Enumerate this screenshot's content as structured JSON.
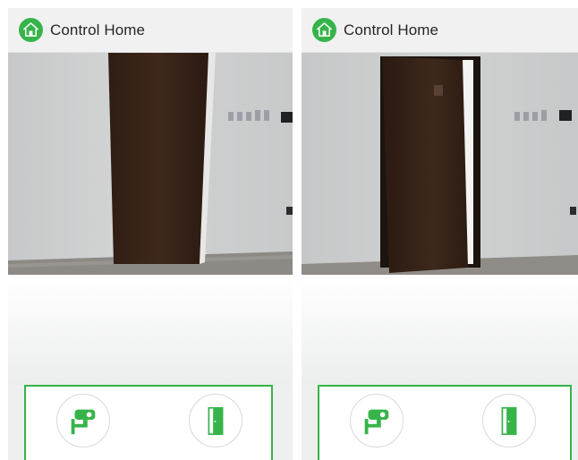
{
  "screens": [
    {
      "app_title": "Control Home",
      "camera_view": {
        "door_state": "closed"
      },
      "controls": {
        "camera_icon": "cctv-camera-icon",
        "door_icon": "door-icon"
      }
    },
    {
      "app_title": "Control Home",
      "camera_view": {
        "door_state": "open"
      },
      "controls": {
        "camera_icon": "cctv-camera-icon",
        "door_icon": "door-icon"
      }
    }
  ],
  "colors": {
    "accent": "#36b44a",
    "appbar": "#f1f1f1",
    "door": "#3a2418",
    "wall": "#c9cbcc"
  }
}
